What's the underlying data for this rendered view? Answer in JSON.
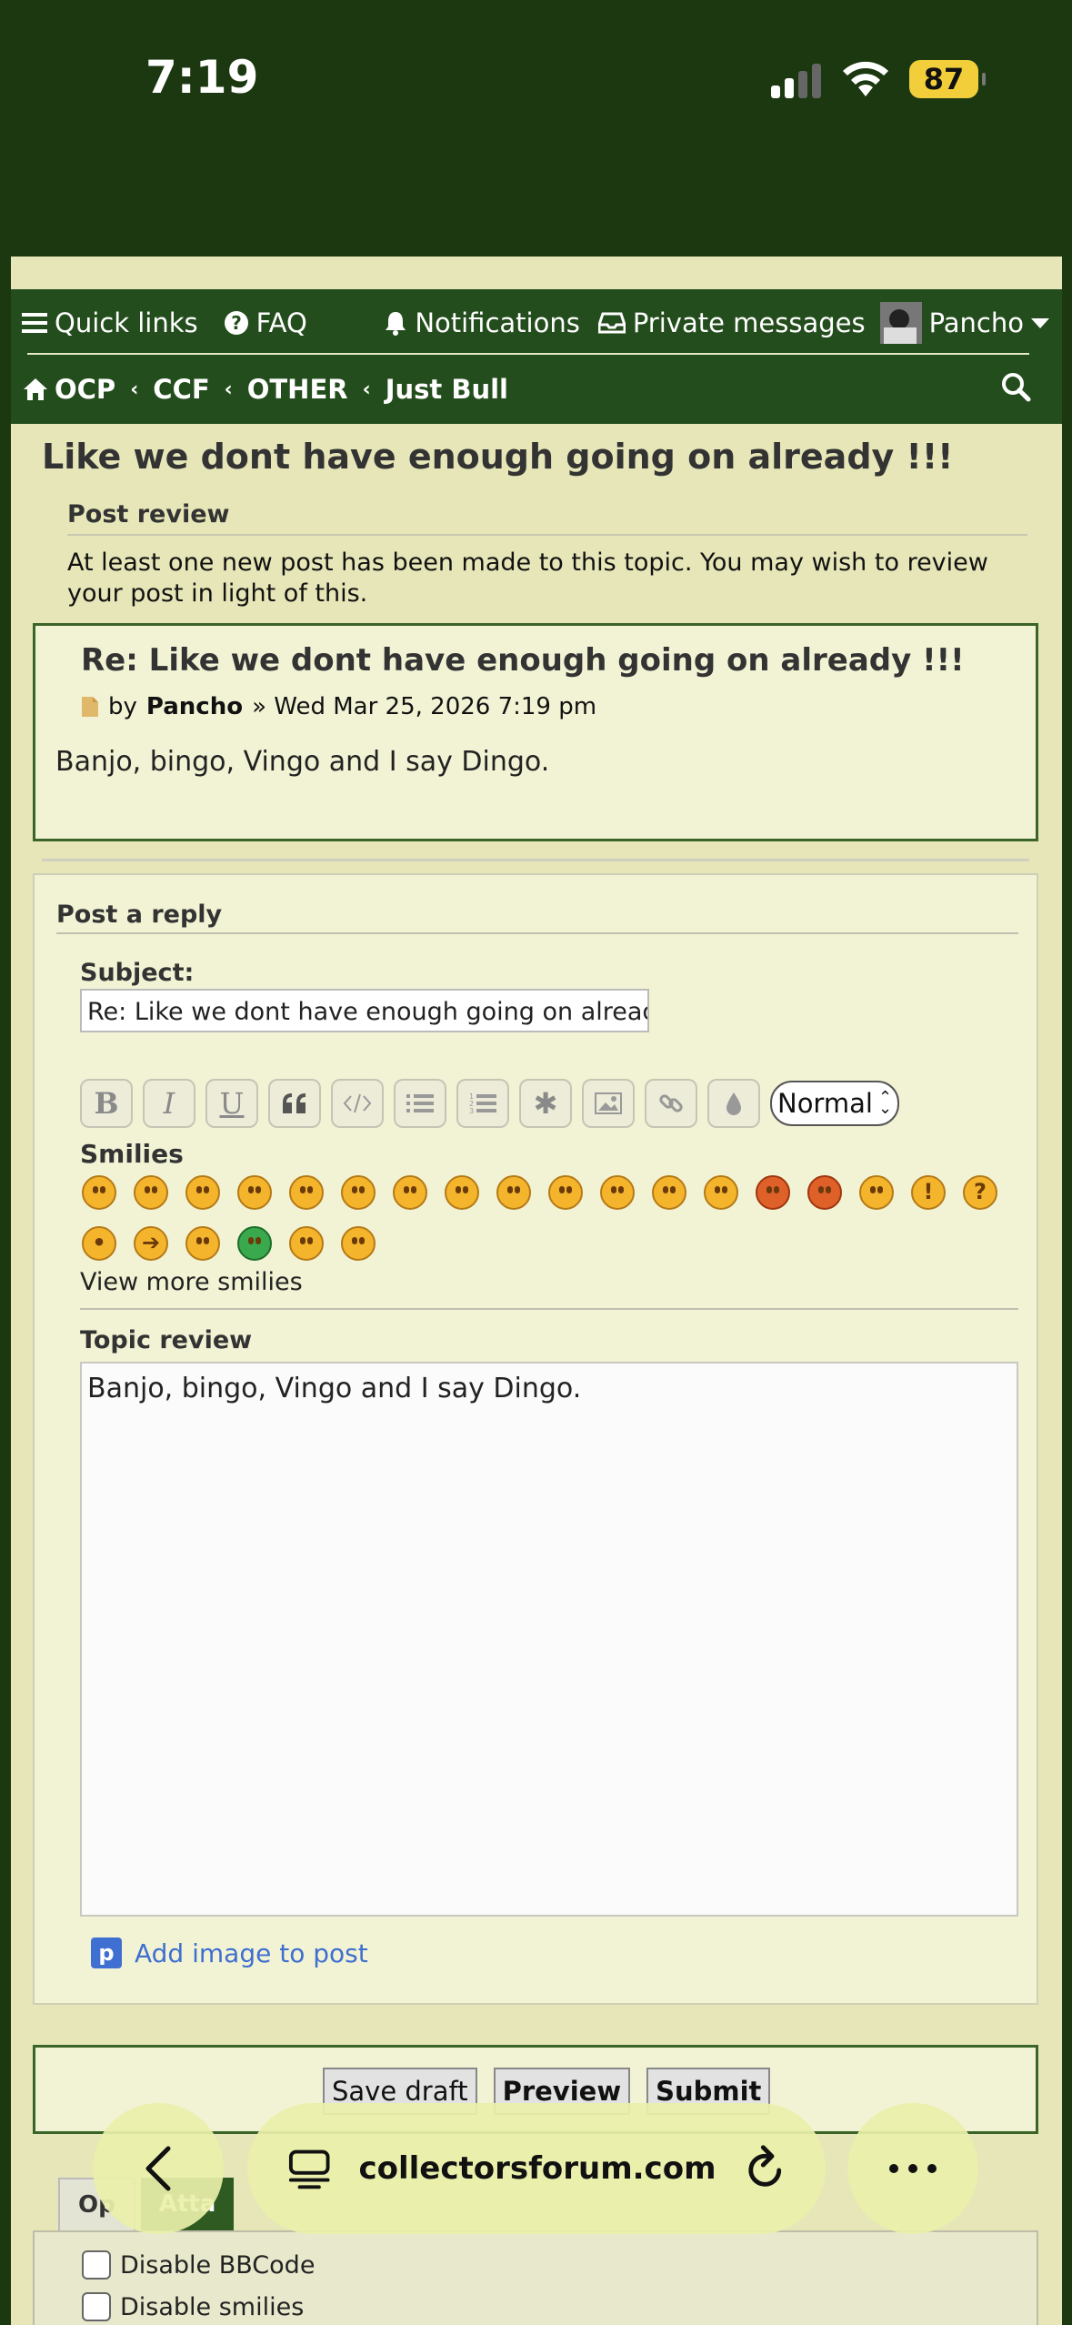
{
  "status": {
    "time": "7:19",
    "battery": "87"
  },
  "nav": {
    "quick_links": "Quick links",
    "faq": "FAQ",
    "notifications": "Notifications",
    "private_messages": "Private messages",
    "user": "Pancho",
    "breadcrumbs": [
      "OCP",
      "CCF",
      "OTHER",
      "Just Bull"
    ]
  },
  "page": {
    "title": "Like we dont have enough going on already !!!",
    "post_review_heading": "Post review",
    "notice": "At least one new post has been made to this topic. You may wish to review your post in light of this."
  },
  "post": {
    "title": "Re: Like we dont have enough going on already !!!",
    "by": "by",
    "author": "Pancho",
    "date": "» Wed Mar 25, 2026 7:19 pm",
    "body": "Banjo, bingo, Vingo and I say Dingo."
  },
  "reply": {
    "heading": "Post a reply",
    "subject_label": "Subject:",
    "subject_value": "Re: Like we dont have enough going on already !!!",
    "font_size_select": "Normal",
    "smilies_label": "Smilies",
    "view_more_smilies": "View more smilies",
    "topic_review_label": "Topic review",
    "message": "Banjo, bingo, Vingo and I say Dingo.",
    "add_image": "Add image to post",
    "add_image_icon_letter": "p"
  },
  "buttons": {
    "save_draft": "Save draft",
    "preview": "Preview",
    "submit": "Submit"
  },
  "tabs": [
    "Op",
    "Atta"
  ],
  "options": {
    "disable_bbcode": "Disable BBCode",
    "disable_smilies": "Disable smilies"
  },
  "browser": {
    "url": "collectorsforum.com"
  },
  "colors": {
    "navbar": "#244d1d",
    "page_bg": "#e6e6b8",
    "panel_bg": "#f2f3d4",
    "link": "#3f6fd0"
  }
}
